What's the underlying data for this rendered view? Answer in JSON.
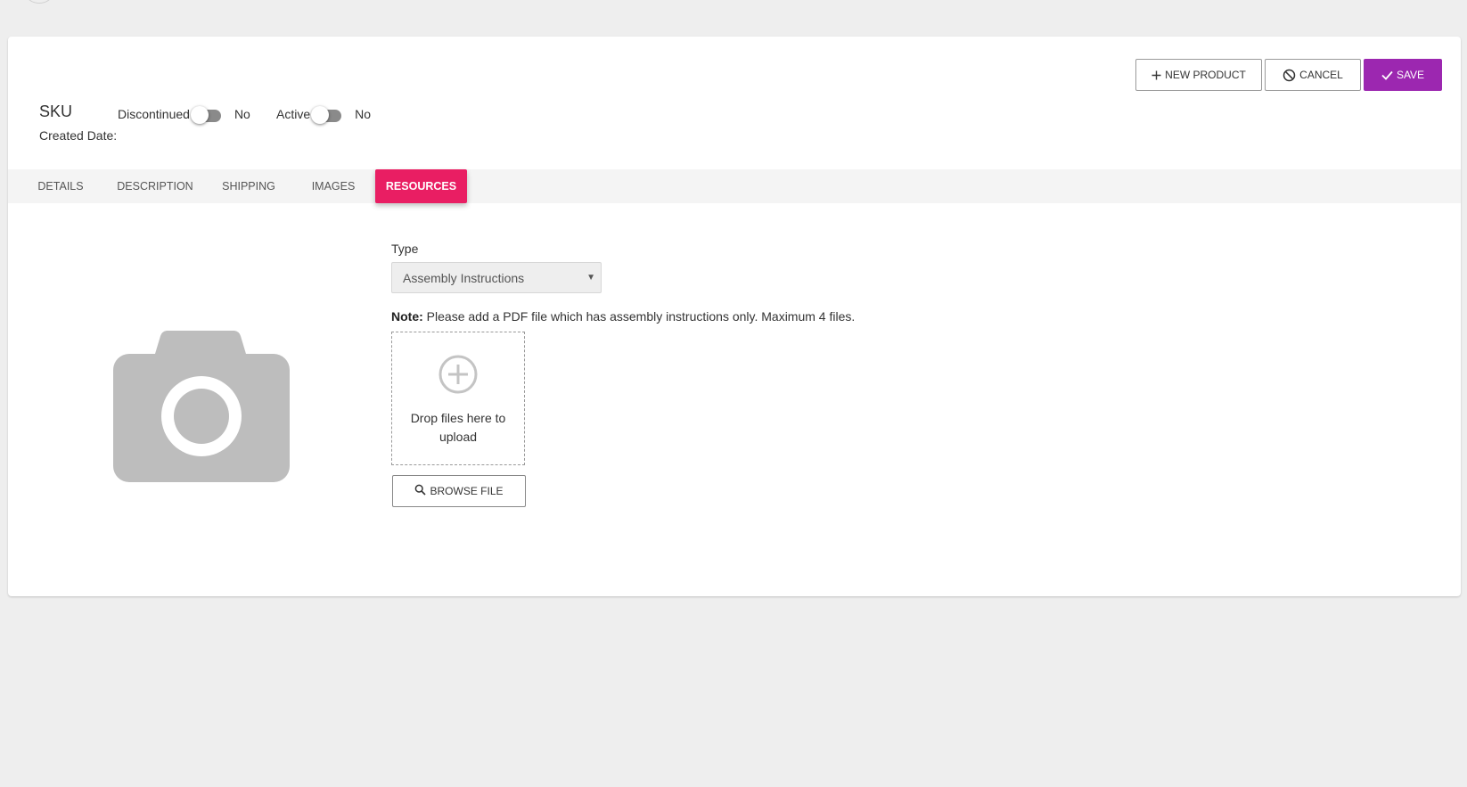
{
  "header": {
    "sku_label": "SKU",
    "created_date_label": "Created Date:",
    "toggles": [
      {
        "label": "Discontinued",
        "value": "No"
      },
      {
        "label": "Active",
        "value": "No"
      }
    ]
  },
  "actions": {
    "new_product": "New Product",
    "cancel": "Cancel",
    "save": "Save"
  },
  "tabs": [
    {
      "label": "Details"
    },
    {
      "label": "Description"
    },
    {
      "label": "Shipping"
    },
    {
      "label": "Images"
    },
    {
      "label": "Resources"
    }
  ],
  "active_tab": "Resources",
  "resources": {
    "type_label": "Type",
    "type_selected": "Assembly Instructions",
    "note_label": "Note:",
    "note_text": "Please add a PDF file which has assembly instructions only. Maximum 4 files.",
    "dropzone_text": "Drop files here to upload",
    "browse_label": "Browse File"
  },
  "colors": {
    "accent_save": "#9c27b0",
    "accent_tab": "#e91e63",
    "placeholder_gray": "#bdbdbd"
  },
  "icons": {
    "new_product": "plus-icon",
    "cancel": "block-icon",
    "save": "check-icon",
    "browse": "search-icon",
    "dropzone": "add-circle-icon",
    "product_image": "camera-icon"
  }
}
